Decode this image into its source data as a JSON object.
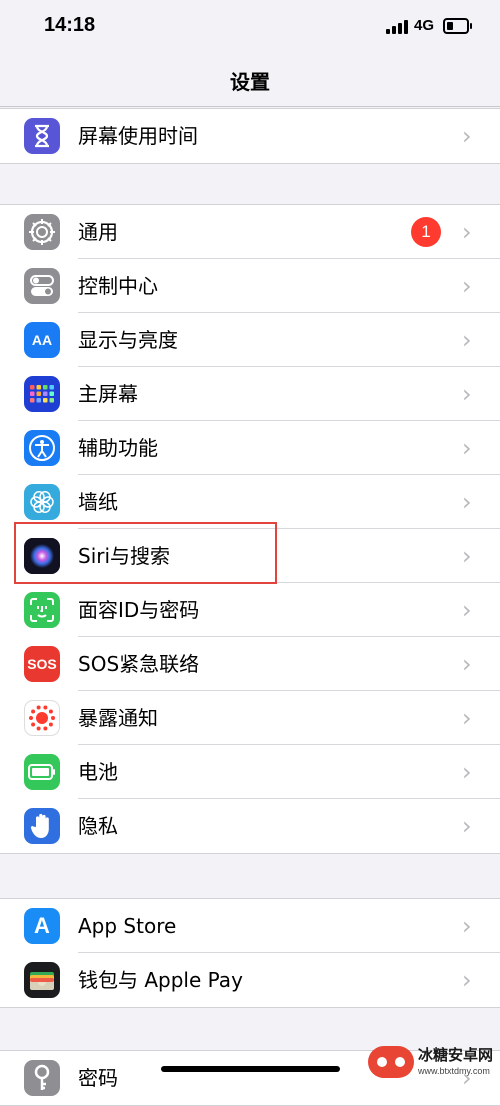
{
  "status_bar": {
    "time": "14:18",
    "network": "4G"
  },
  "nav": {
    "title": "设置"
  },
  "groups": [
    [
      {
        "name": "screen-time",
        "label": "屏幕使用时间",
        "icon": "hourglass-icon",
        "color": "#5856d6"
      }
    ],
    [
      {
        "name": "general",
        "label": "通用",
        "icon": "gear-icon",
        "color": "#8e8e93",
        "badge": "1"
      },
      {
        "name": "control-center",
        "label": "控制中心",
        "icon": "toggles-icon",
        "color": "#8e8e93"
      },
      {
        "name": "display-brightness",
        "label": "显示与亮度",
        "icon": "text-size-icon",
        "color": "#1a7cf5",
        "glyph": "AA"
      },
      {
        "name": "home-screen",
        "label": "主屏幕",
        "icon": "app-grid-icon",
        "color": "#1f3fd4"
      },
      {
        "name": "accessibility",
        "label": "辅助功能",
        "icon": "accessibility-icon",
        "color": "#1a7cf5"
      },
      {
        "name": "wallpaper",
        "label": "墙纸",
        "icon": "flower-icon",
        "color": "#35aadc"
      },
      {
        "name": "siri-search",
        "label": "Siri与搜索",
        "icon": "siri-icon",
        "color": "#111122"
      },
      {
        "name": "face-id",
        "label": "面容ID与密码",
        "icon": "face-id-icon",
        "color": "#34c759"
      },
      {
        "name": "emergency-sos",
        "label": "SOS紧急联络",
        "icon": "sos-icon",
        "color": "#e9382f",
        "glyph": "SOS"
      },
      {
        "name": "exposure",
        "label": "暴露通知",
        "icon": "exposure-icon",
        "color": "#ffffff"
      },
      {
        "name": "battery",
        "label": "电池",
        "icon": "battery-icon",
        "color": "#34c759"
      },
      {
        "name": "privacy",
        "label": "隐私",
        "icon": "hand-icon",
        "color": "#2f6fe0"
      }
    ],
    [
      {
        "name": "app-store",
        "label": "App Store",
        "icon": "app-store-icon",
        "color": "#1a8cf5",
        "glyph": "A"
      },
      {
        "name": "wallet",
        "label": "钱包与 Apple Pay",
        "icon": "wallet-icon",
        "color": "#1c1c1e"
      }
    ],
    [
      {
        "name": "passwords",
        "label": "密码",
        "icon": "key-icon",
        "color": "#8e8e93"
      }
    ]
  ],
  "watermark": {
    "title": "冰糖安卓网",
    "url": "www.btxtdmy.com"
  }
}
